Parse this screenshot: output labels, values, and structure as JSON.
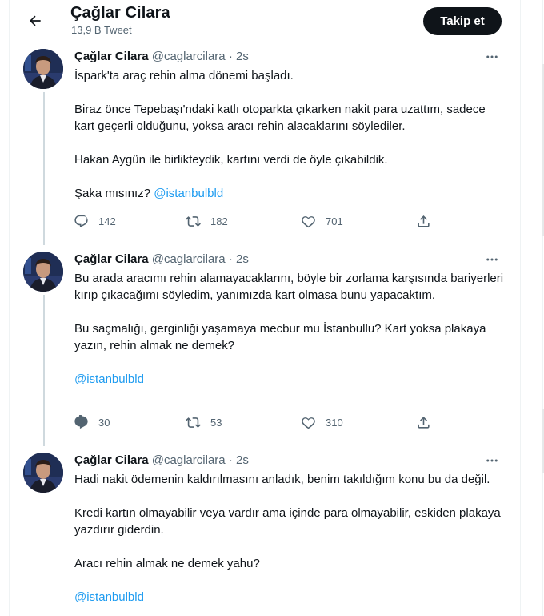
{
  "header": {
    "name": "Çağlar Cilara",
    "tweet_count": "13,9 B Tweet",
    "follow_label": "Takip et"
  },
  "tweets": [
    {
      "name": "Çağlar Cilara",
      "handle": "@caglarcilara",
      "time": " · 2s",
      "paragraphs": [
        "İspark'ta araç rehin alma dönemi başladı.",
        "Biraz önce Tepebaşı'ndaki katlı otoparkta çıkarken nakit para uzattım, sadece kart geçerli olduğunu, yoksa aracı rehin alacaklarını söylediler.",
        "Hakan Aygün ile birlikteydik, kartını verdi de öyle çıkabildik.",
        "Şaka mısınız? "
      ],
      "mention": "@istanbulbld",
      "replies": "142",
      "retweets": "182",
      "likes": "701"
    },
    {
      "name": "Çağlar Cilara",
      "handle": "@caglarcilara",
      "time": " · 2s",
      "paragraphs": [
        "Bu arada aracımı rehin alamayacaklarını, böyle bir zorlama karşısında bariyerleri kırıp çıkacağımı söyledim, yanımızda kart olmasa bunu yapacaktım.",
        "Bu saçmalığı, gerginliği yaşamaya mecbur mu İstanbullu? Kart yoksa plakaya yazın, rehin almak ne demek?"
      ],
      "mention": "@istanbulbld",
      "replies": "30",
      "retweets": "53",
      "likes": "310"
    },
    {
      "name": "Çağlar Cilara",
      "handle": "@caglarcilara",
      "time": " · 2s",
      "paragraphs": [
        "Hadi nakit ödemenin kaldırılmasını anladık, benim takıldığım konu bu da değil.",
        "Kredi kartın olmayabilir veya vardır ama içinde para olmayabilir, eskiden plakaya yazdırır giderdin.",
        "Aracı rehin almak ne demek yahu?"
      ],
      "mention": "@istanbulbld"
    }
  ],
  "icons": {
    "back": "arrow-left-icon",
    "more": "more-horizontal-icon",
    "reply": "reply-icon",
    "retweet": "retweet-icon",
    "like": "heart-icon",
    "share": "share-icon"
  },
  "colors": {
    "accent": "#1d9bf0",
    "text": "#0f1419",
    "secondary": "#536471",
    "follow_bg": "#0f1419"
  }
}
